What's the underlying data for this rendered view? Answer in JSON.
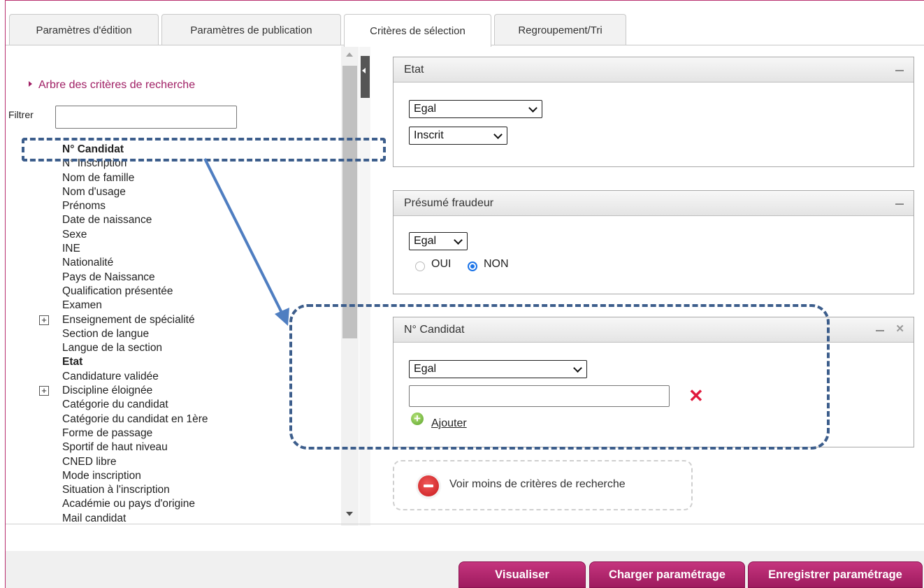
{
  "tabs": [
    {
      "label": "Paramètres d'édition"
    },
    {
      "label": "Paramètres de publication"
    },
    {
      "label": "Critères de sélection",
      "active": true
    },
    {
      "label": "Regroupement/Tri"
    }
  ],
  "left": {
    "tree_title": "Arbre des critères de recherche",
    "filter_label": "Filtrer",
    "filter_value": "",
    "items": [
      {
        "label": "N° Candidat",
        "bold": true
      },
      {
        "label": "N° Inscription"
      },
      {
        "label": "Nom de famille"
      },
      {
        "label": "Nom d'usage"
      },
      {
        "label": "Prénoms"
      },
      {
        "label": "Date de naissance"
      },
      {
        "label": "Sexe"
      },
      {
        "label": "INE"
      },
      {
        "label": "Nationalité"
      },
      {
        "label": "Pays de Naissance"
      },
      {
        "label": "Qualification présentée"
      },
      {
        "label": "Examen"
      },
      {
        "label": "Enseignement de spécialité",
        "expandable": true,
        "expander": "+"
      },
      {
        "label": "Section de langue"
      },
      {
        "label": "Langue de la section"
      },
      {
        "label": "Etat",
        "bold": true
      },
      {
        "label": "Candidature validée"
      },
      {
        "label": "Discipline éloignée",
        "expandable": true,
        "expander": "+"
      },
      {
        "label": "Catégorie du candidat"
      },
      {
        "label": "Catégorie du candidat en 1ère"
      },
      {
        "label": "Forme de passage"
      },
      {
        "label": "Sportif de haut niveau"
      },
      {
        "label": "CNED libre"
      },
      {
        "label": "Mode inscription"
      },
      {
        "label": "Situation à l'inscription"
      },
      {
        "label": "Académie ou pays d'origine"
      },
      {
        "label": "Mail candidat"
      }
    ]
  },
  "panels": {
    "etat": {
      "title": "Etat",
      "operator": "Egal",
      "value": "Inscrit"
    },
    "fraudeur": {
      "title": "Présumé fraudeur",
      "operator": "Egal",
      "option_oui": "OUI",
      "option_non": "NON",
      "selected": "NON"
    },
    "candidat": {
      "title": "N° Candidat",
      "operator": "Egal",
      "value": "",
      "add_label": "Ajouter"
    }
  },
  "more_label": "Voir moins de critères de recherche",
  "buttons": {
    "visualiser": "Visualiser",
    "charger": "Charger paramétrage",
    "enregistrer": "Enregistrer paramétrage"
  },
  "colors": {
    "accent": "#a02065",
    "annotation": "#3d5e8c",
    "radio": "#1a73e8",
    "delete": "#e0193c"
  }
}
